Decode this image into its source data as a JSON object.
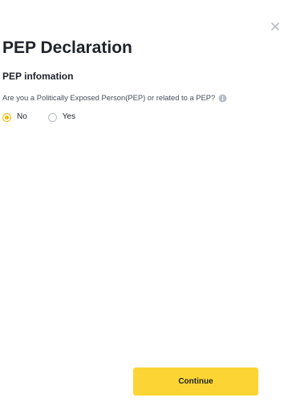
{
  "dialog": {
    "title": "PEP Declaration",
    "close_icon": "close-icon"
  },
  "section": {
    "title": "PEP infomation",
    "question": "Are you a Politically Exposed Person(PEP) or related to a PEP?",
    "info_icon": "info-icon"
  },
  "options": [
    {
      "label": "No",
      "selected": true
    },
    {
      "label": "Yes",
      "selected": false
    }
  ],
  "actions": {
    "continue_label": "Continue"
  },
  "colors": {
    "accent": "#f0b90b",
    "button_bg": "#fcd535",
    "text_primary": "#1e2329",
    "text_secondary": "#474d57"
  }
}
